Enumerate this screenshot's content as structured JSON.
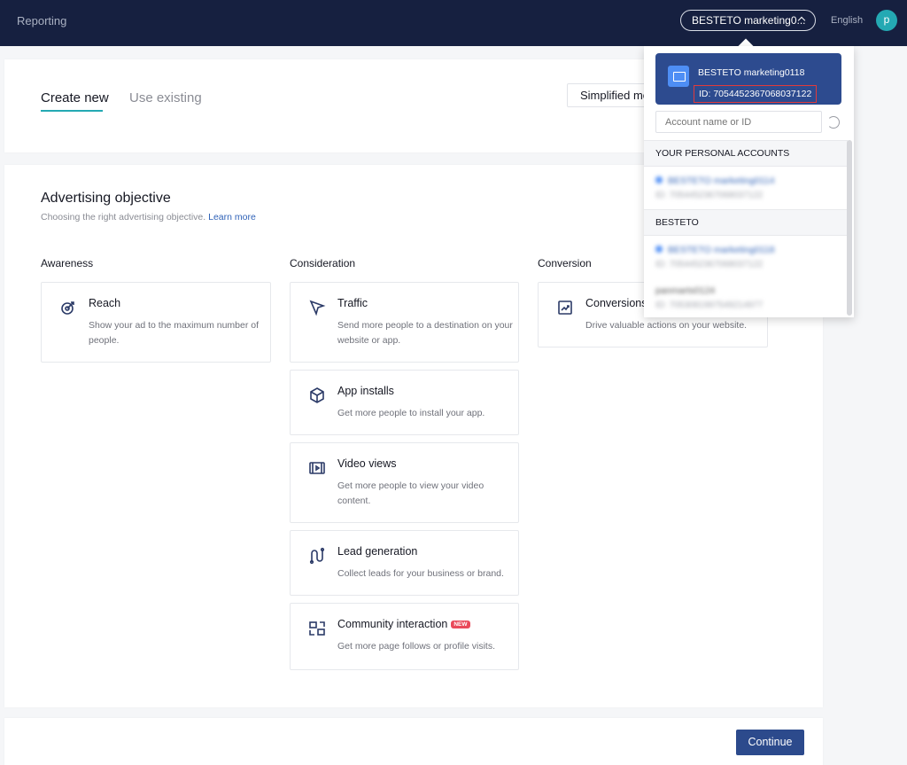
{
  "header": {
    "reporting_label": "Reporting",
    "account_button_label": "BESTETO marketing0...",
    "language": "English",
    "avatar_letter": "p"
  },
  "tabs": [
    {
      "label": "Create new",
      "active": true
    },
    {
      "label": "Use existing",
      "active": false
    }
  ],
  "mode_button_label": "Simplified mo",
  "objective": {
    "title": "Advertising objective",
    "subtitle": "Choosing the right advertising objective.",
    "learn_more": "Learn more"
  },
  "columns": [
    {
      "title": "Awareness",
      "items": [
        {
          "icon": "reach-icon",
          "title": "Reach",
          "desc": "Show your ad to the maximum number of people."
        }
      ]
    },
    {
      "title": "Consideration",
      "items": [
        {
          "icon": "cursor-icon",
          "title": "Traffic",
          "desc": "Send more people to a destination on your website or app."
        },
        {
          "icon": "cube-icon",
          "title": "App installs",
          "desc": "Get more people to install your app."
        },
        {
          "icon": "film-icon",
          "title": "Video views",
          "desc": "Get more people to view your video content."
        },
        {
          "icon": "funnel-icon",
          "title": "Lead generation",
          "desc": "Collect leads for your business or brand."
        },
        {
          "icon": "community-icon",
          "title": "Community interaction",
          "badge": "NEW",
          "desc": "Get more page follows or profile visits."
        }
      ]
    },
    {
      "title": "Conversion",
      "items": [
        {
          "icon": "trend-icon",
          "title": "Conversions",
          "desc": "Drive valuable actions on your website."
        }
      ]
    }
  ],
  "continue_label": "Continue",
  "account_dropdown": {
    "current": {
      "name": "BESTETO marketing0118",
      "id": "ID: 7054452367068037122"
    },
    "search_placeholder": "Account name or ID",
    "groups": [
      {
        "title": "YOUR PERSONAL ACCOUNTS",
        "items": [
          {
            "name": "BESTETO marketing0114",
            "id": "ID: 7054452367068037122"
          }
        ]
      },
      {
        "title": "BESTETO",
        "items": [
          {
            "name": "BESTETO marketing0118",
            "id": "ID: 7054452367068037122"
          },
          {
            "name": "panmarts0124",
            "id": "ID: 7053081997549214977"
          }
        ]
      }
    ]
  }
}
